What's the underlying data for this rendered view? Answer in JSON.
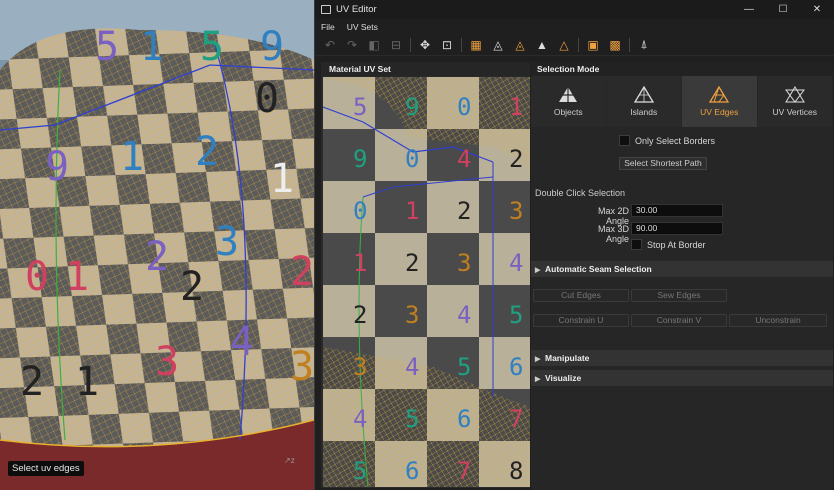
{
  "viewport": {
    "status_label": "Select uv edges",
    "checker_numbers": [
      "5",
      "1",
      "5",
      "9",
      "0",
      "9",
      "1",
      "2",
      "1",
      "0",
      "1",
      "2",
      "3",
      "2",
      "2",
      "1",
      "3",
      "4",
      "3",
      "2"
    ]
  },
  "window": {
    "title": "UV Editor",
    "controls": {
      "minimize": "—",
      "maximize": "☐",
      "close": "✕"
    }
  },
  "menu": {
    "file": "File",
    "uvsets": "UV Sets"
  },
  "toolbar": {
    "icons": [
      "undo-icon",
      "redo-icon",
      "mirror-icon",
      "flip-icon",
      "move-icon",
      "fit-icon",
      "grid-icon",
      "uv-edges-icon",
      "uv-edges-active-icon",
      "polygon-icon",
      "polygon-outline-icon",
      "texture-icon",
      "checker-icon",
      "pin-icon"
    ]
  },
  "uv_panel": {
    "title": "Material UV Set",
    "numbers": [
      "5",
      "9",
      "0",
      "1",
      "9",
      "0",
      "4",
      "2",
      "0",
      "1",
      "2",
      "3",
      "1",
      "2",
      "3",
      "4",
      "2",
      "3",
      "4",
      "5",
      "3",
      "4",
      "5",
      "6",
      "4",
      "5",
      "6",
      "7",
      "5",
      "6",
      "7",
      "8"
    ]
  },
  "selection": {
    "title": "Selection Mode",
    "modes": [
      {
        "label": "Objects"
      },
      {
        "label": "Islands"
      },
      {
        "label": "UV Edges"
      },
      {
        "label": "UV Vertices"
      }
    ],
    "only_select_borders": "Only Select Borders",
    "select_shortest_path": "Select Shortest Path",
    "double_click_title": "Double Click Selection",
    "max_2d_label": "Max 2D Angle",
    "max_2d_value": "30.00",
    "max_3d_label": "Max 3D Angle",
    "max_3d_value": "90.00",
    "stop_at_border": "Stop At Border",
    "auto_seam": "Automatic Seam Selection",
    "cut_edges": "Cut Edges",
    "sew_edges": "Sew Edges",
    "constrain_u": "Constrain U",
    "constrain_v": "Constrain V",
    "unconstrain": "Unconstrain",
    "manipulate": "Manipulate",
    "visualize": "Visualize"
  },
  "colors": {
    "accent": "#f0a040",
    "wire": "#e8b030",
    "seam": "#3040d0"
  }
}
